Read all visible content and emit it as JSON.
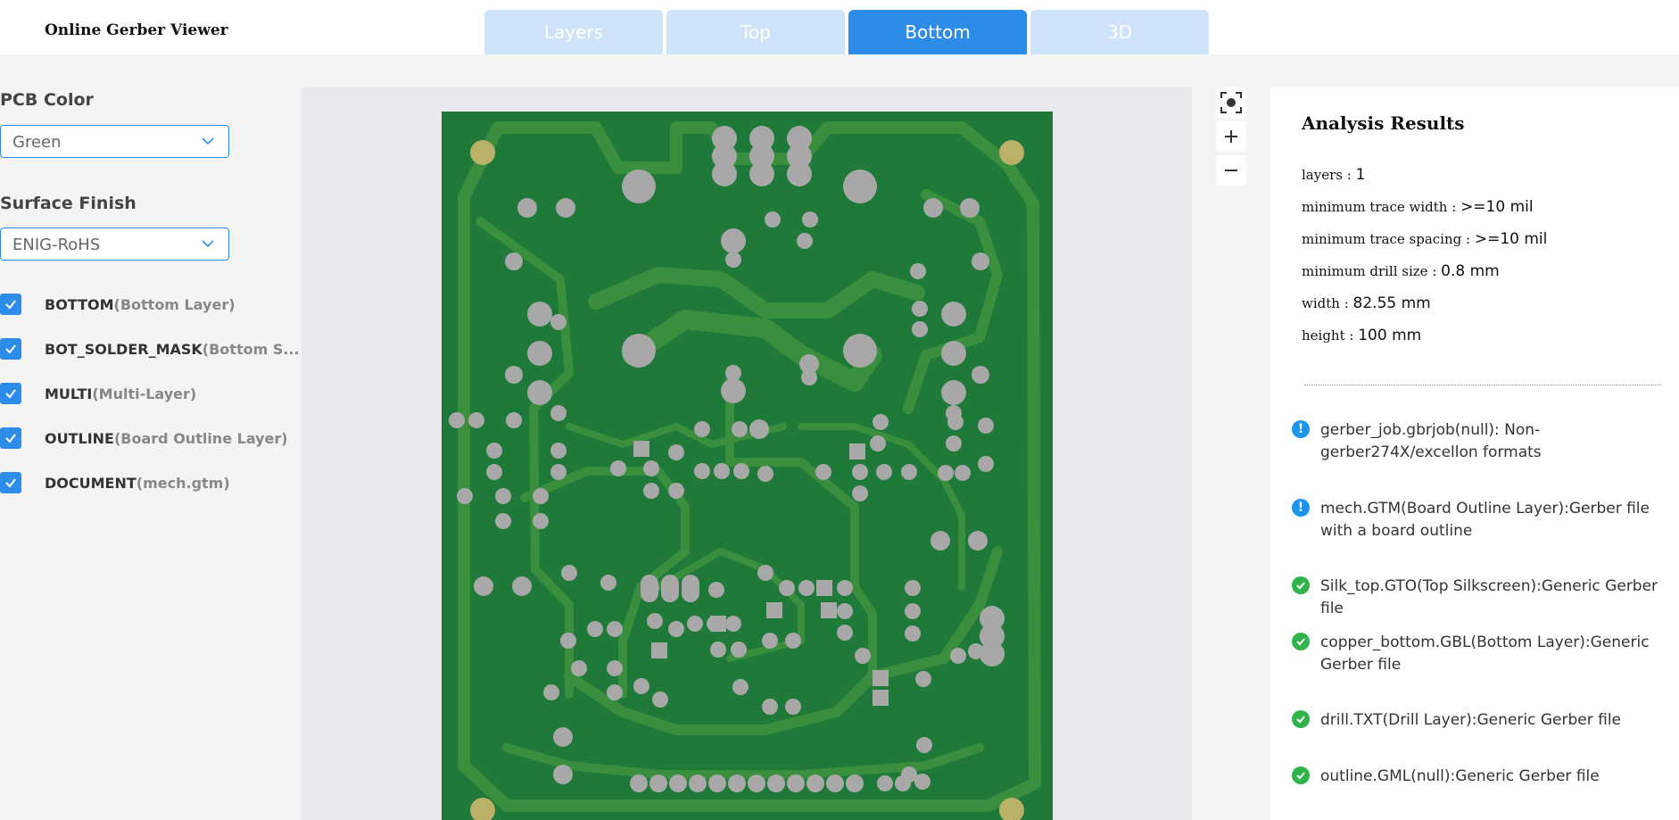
{
  "app_title": "Online Gerber Viewer",
  "tabs": [
    {
      "label": "Layers",
      "active": false
    },
    {
      "label": "Top",
      "active": false
    },
    {
      "label": "Bottom",
      "active": true
    },
    {
      "label": "3D",
      "active": false
    }
  ],
  "sidebar": {
    "pcb_color_label": "PCB Color",
    "pcb_color_value": "Green",
    "surface_finish_label": "Surface Finish",
    "surface_finish_value": "ENIG-RoHS",
    "layers": [
      {
        "code": "BOTTOM",
        "desc": "(Bottom Layer)",
        "checked": true
      },
      {
        "code": "BOT_SOLDER_MASK",
        "desc": "(Bottom S...",
        "checked": true
      },
      {
        "code": "MULTI",
        "desc": "(Multi-Layer)",
        "checked": true
      },
      {
        "code": "OUTLINE",
        "desc": "(Board Outline Layer)",
        "checked": true
      },
      {
        "code": "DOCUMENT",
        "desc": "(mech.gtm)",
        "checked": true
      }
    ]
  },
  "viewer": {
    "board_color": "#1f7a39",
    "trace_color": "#3a8f3f",
    "pad_color": "#a8a8a8",
    "mount_hole_color": "#b9b167"
  },
  "tools": [
    {
      "icon": "fit-view-icon"
    },
    {
      "icon": "zoom-in-icon"
    },
    {
      "icon": "zoom-out-icon"
    }
  ],
  "results": {
    "title": "Analysis Results",
    "metrics": [
      {
        "label": "layers : ",
        "value": "1"
      },
      {
        "label": "minimum trace width : ",
        "value": ">=10 mil"
      },
      {
        "label": "minimum trace spacing : ",
        "value": ">=10 mil"
      },
      {
        "label": "minimum drill size : ",
        "value": "0.8 mm"
      },
      {
        "label": "width : ",
        "value": "82.55 mm"
      },
      {
        "label": "height : ",
        "value": "100 mm"
      }
    ],
    "files": [
      {
        "status": "info",
        "text": "gerber_job.gbrjob(null): Non-gerber274X/excellon formats"
      },
      {
        "status": "info",
        "text": "mech.GTM(Board Outline Layer):Gerber file with a board outline"
      },
      {
        "status": "ok",
        "text": "Silk_top.GTO(Top Silkscreen):Generic Gerber file"
      },
      {
        "status": "ok",
        "text": "copper_bottom.GBL(Bottom Layer):Generic Gerber file"
      },
      {
        "status": "ok",
        "text": "drill.TXT(Drill Layer):Generic Gerber file"
      },
      {
        "status": "ok",
        "text": "outline.GML(null):Generic Gerber file"
      }
    ]
  },
  "colors": {
    "accent": "#2d8ce8",
    "tab_inactive": "#cfe3fb",
    "info": "#1a94ec",
    "ok": "#2fb34a"
  }
}
